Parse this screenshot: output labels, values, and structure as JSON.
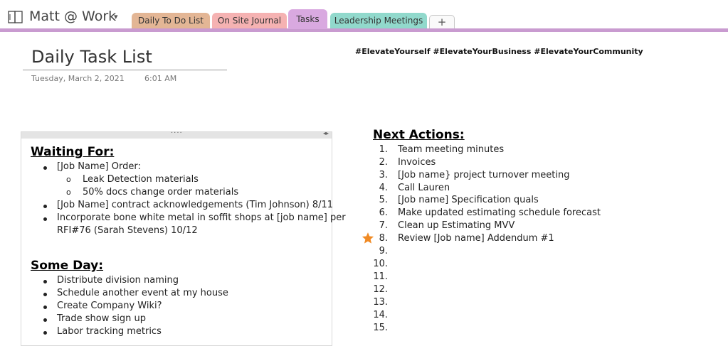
{
  "notebook": {
    "title": "Matt @ Work",
    "icon": "notebook-icon",
    "caret": "▾"
  },
  "tabs": [
    {
      "label": "Daily To Do List",
      "color": "#e3b695"
    },
    {
      "label": "On Site Journal",
      "color": "#f5b2b2"
    },
    {
      "label": "Tasks",
      "color": "#d9a9e0"
    },
    {
      "label": "Leadership Meetings",
      "color": "#91d9cc"
    }
  ],
  "add_tab_label": "+",
  "page": {
    "title": "Daily Task List",
    "date": "Tuesday, March 2, 2021",
    "time": "6:01 AM",
    "hashtags": "#ElevateYourself #ElevateYourBusiness #ElevateYourCommunity"
  },
  "container": {
    "handle_dots": "····",
    "handle_arrows": "◂▸"
  },
  "waiting_for": {
    "heading": "Waiting For:",
    "item1": "[Job Name] Order:",
    "sub1": "Leak Detection materials",
    "sub2": "50% docs change order materials",
    "item2": "[Job Name] contract acknowledgements (Tim Johnson) 8/11",
    "item3_line1": "Incorporate bone white metal in soffit shops at [job name] per",
    "item3_line2": "RFI#76 (Sarah Stevens) 10/12",
    "sub_bullet": "o"
  },
  "some_day": {
    "heading": "Some Day:",
    "items": [
      "Distribute division naming",
      "Schedule another event at my house",
      "Create Company Wiki?",
      "Trade show sign up",
      "Labor tracking metrics"
    ]
  },
  "next_actions": {
    "heading": "Next Actions:",
    "numbers": [
      "1.",
      "2.",
      "3.",
      "4.",
      "5.",
      "6.",
      "7.",
      "8.",
      "9.",
      "10.",
      "11.",
      "12.",
      "13.",
      "14.",
      "15."
    ],
    "items": [
      "Team meeting minutes",
      "Invoices",
      "[Job name} project turnover meeting",
      "Call Lauren",
      "[Job name] Specification quals",
      "Make updated estimating schedule forecast",
      "Clean up Estimating MVV",
      "Review [Job name] Addendum #1"
    ],
    "starred_item_icon": "star-icon",
    "star_color": "#f08a24"
  }
}
